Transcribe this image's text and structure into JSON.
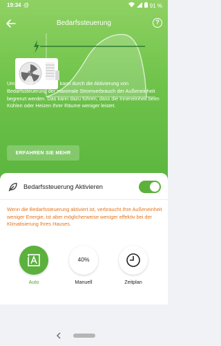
{
  "status_bar": {
    "time": "19:34",
    "at_symbol": "@",
    "battery": "91 %"
  },
  "toolbar": {
    "title": "Bedarfssteuerung",
    "help_label": "?"
  },
  "description": "Um Energie zu sparen, kann durch die Aktivierung von Bedarfssteuerung der maximale Stromverbrauch der Außeneinheit begrenzt werden. Das kann dazu führen, dass die Inneneinheit beim Kühlen oder Heizen Ihrer Räume weniger leistet.",
  "learn_more_label": "ERFAHREN SIE MEHR",
  "toggle": {
    "label": "Bedarfssteuerung Aktivieren",
    "on": true
  },
  "warning": "Wenn die Bedarfssteuerung aktiviert ist, verbraucht Ihre Außeneinheit weniger Energie, ist aber möglicherweise weniger effektiv bei der Klimatisierung Ihres Hauses.",
  "modes": [
    {
      "label": "Auto",
      "icon": "auto-a-icon",
      "active": true
    },
    {
      "label": "Manuell",
      "value": "40%",
      "active": false
    },
    {
      "label": "Zeitplan",
      "icon": "clock-icon",
      "active": false
    }
  ],
  "colors": {
    "accent_green": "#5bb13c",
    "warning_orange": "#e5741a"
  }
}
